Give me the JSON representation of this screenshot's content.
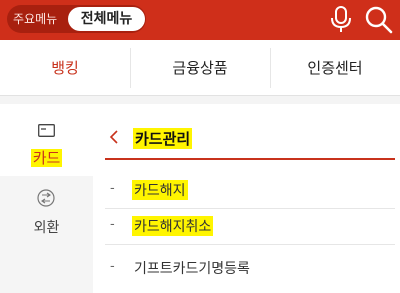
{
  "header": {
    "main_menu_label": "주요메뉴",
    "all_menu_label": "전체메뉴",
    "brand_color": "#cf2f1a",
    "mic_icon": "microphone-icon",
    "search_icon": "search-icon"
  },
  "tabs": [
    {
      "label": "뱅킹",
      "active": true
    },
    {
      "label": "금융상품",
      "active": false
    },
    {
      "label": "인증센터",
      "active": false
    }
  ],
  "sidebar": {
    "items": [
      {
        "label": "카드",
        "icon": "card-icon",
        "active": true,
        "highlighted": true
      },
      {
        "label": "외환",
        "icon": "exchange-icon",
        "active": false
      }
    ]
  },
  "content": {
    "section_title": "카드관리",
    "back_icon": "chevron-left-icon",
    "items": [
      {
        "label": "카드해지",
        "highlighted": true
      },
      {
        "label": "카드해지취소",
        "highlighted": true
      },
      {
        "label": "기프트카드기명등록",
        "highlighted": false
      }
    ]
  },
  "colors": {
    "accent": "#c8321c",
    "highlight": "#fff500"
  }
}
